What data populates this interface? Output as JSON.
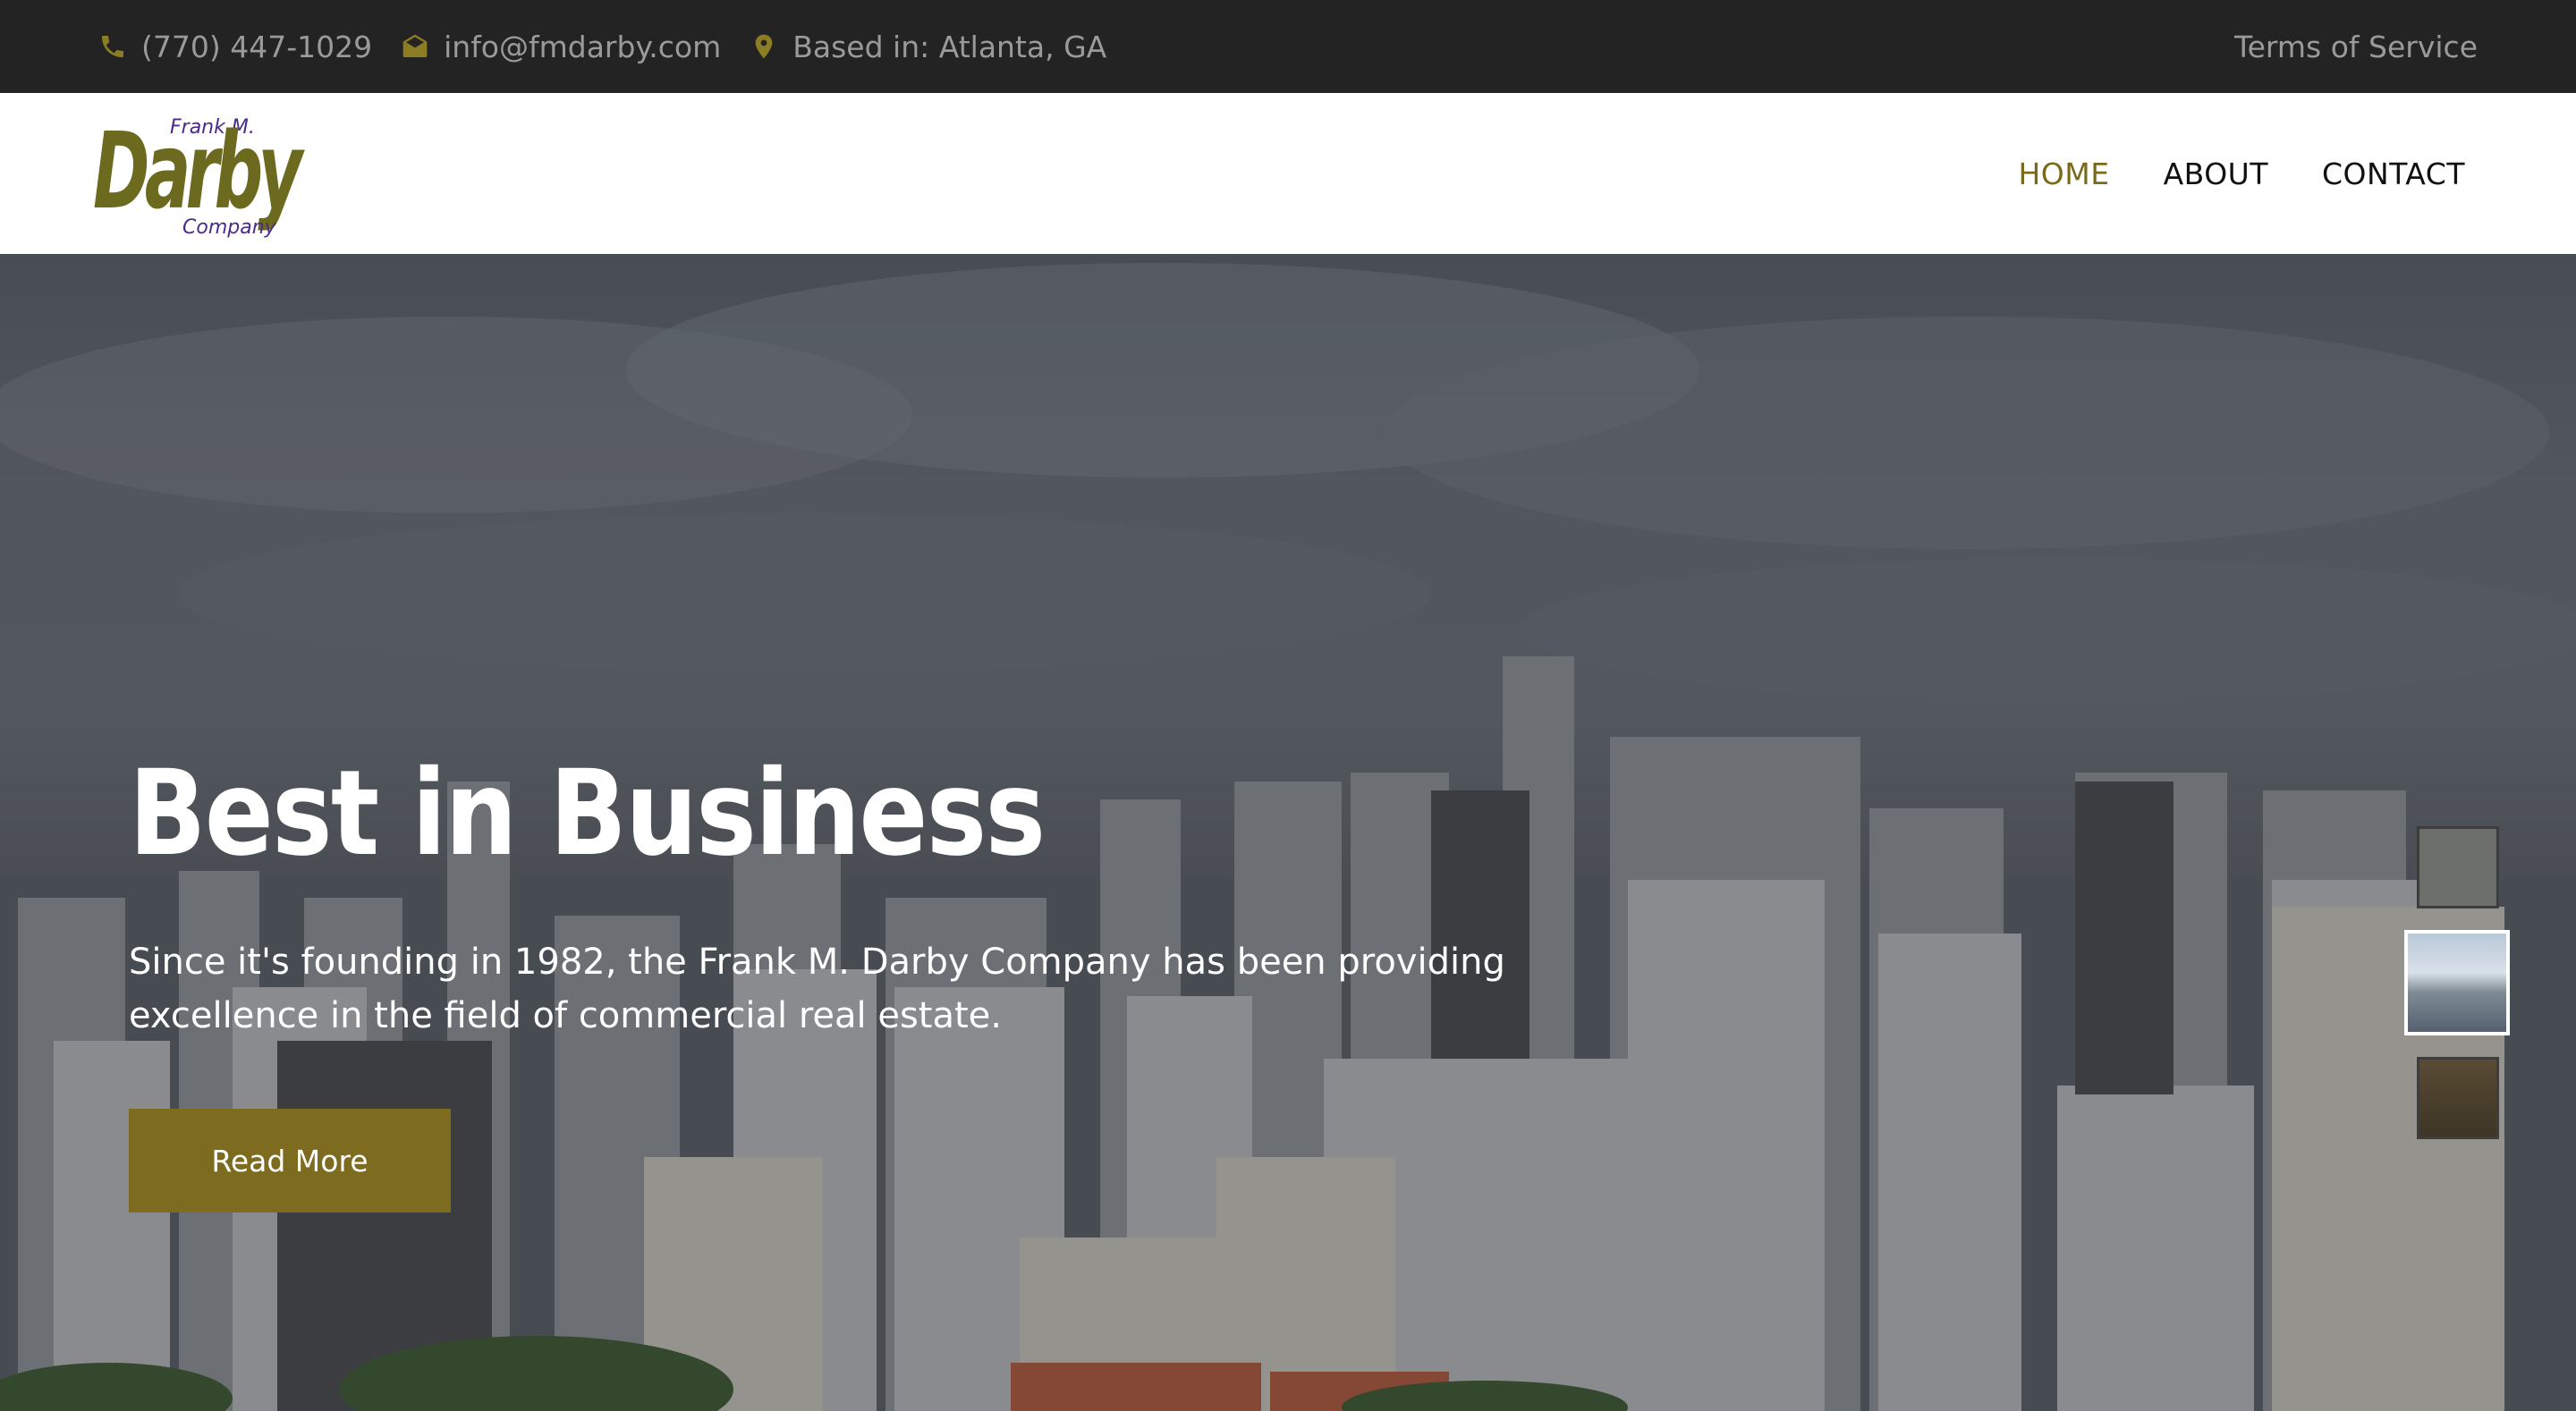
{
  "topbar": {
    "phone": "(770) 447-1029",
    "email": "info@fmdarby.com",
    "location": "Based in: Atlanta, GA",
    "terms": "Terms of Service",
    "icons": [
      "phone-icon",
      "envelope-icon",
      "map-pin-icon"
    ],
    "icon_color": "#8b7d24"
  },
  "logo": {
    "top": "Frank M.",
    "main": "Darby",
    "bottom": "Company"
  },
  "nav": [
    {
      "label": "HOME",
      "active": true
    },
    {
      "label": "ABOUT",
      "active": false
    },
    {
      "label": "CONTACT",
      "active": false
    }
  ],
  "hero": {
    "title": "Best in Business",
    "subtitle": "Since it's founding in 1982, the Frank M. Darby Company has been providing excellence in the field of commercial real estate.",
    "button": "Read More",
    "slides": 3,
    "active_slide": 2
  },
  "colors": {
    "accent": "#7d6b1f",
    "topbar_bg": "#232323"
  }
}
